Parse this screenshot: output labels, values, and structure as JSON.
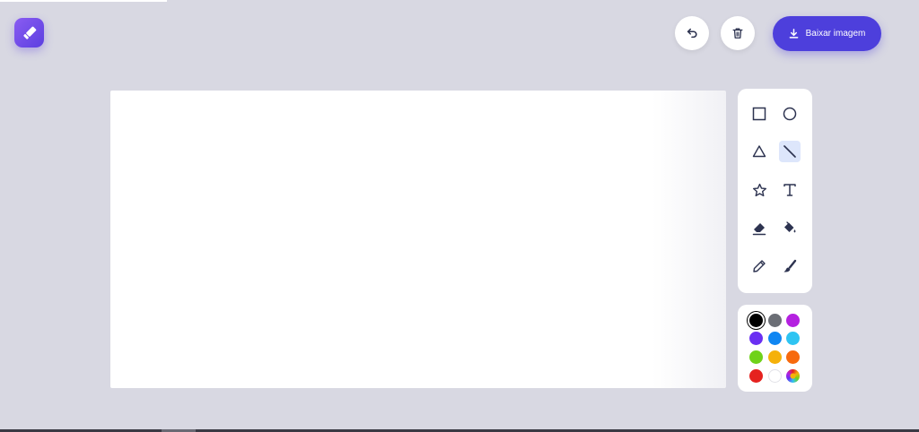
{
  "toolbar": {
    "download_label": "Baixar imagem"
  },
  "icons": {
    "logo": "pen-logo-icon",
    "undo": "undo-icon",
    "trash": "trash-icon",
    "download": "download-icon"
  },
  "tools": [
    {
      "name": "rectangle",
      "icon": "square-icon",
      "active": false
    },
    {
      "name": "circle",
      "icon": "circle-icon",
      "active": false
    },
    {
      "name": "triangle",
      "icon": "triangle-icon",
      "active": false
    },
    {
      "name": "line",
      "icon": "line-icon",
      "active": true
    },
    {
      "name": "star",
      "icon": "star-icon",
      "active": false
    },
    {
      "name": "text",
      "icon": "text-icon",
      "active": false
    },
    {
      "name": "eraser",
      "icon": "eraser-icon",
      "active": false
    },
    {
      "name": "fill",
      "icon": "paint-bucket-icon",
      "active": false
    },
    {
      "name": "pencil",
      "icon": "pencil-icon",
      "active": false
    },
    {
      "name": "brush",
      "icon": "brush-icon",
      "active": false
    }
  ],
  "colors": [
    {
      "name": "black",
      "hex": "#000000",
      "selected": true
    },
    {
      "name": "gray",
      "hex": "#6b6e75",
      "selected": false
    },
    {
      "name": "purple",
      "hex": "#b421e0",
      "selected": false
    },
    {
      "name": "violet",
      "hex": "#6a2ff2",
      "selected": false
    },
    {
      "name": "blue",
      "hex": "#0f86f2",
      "selected": false
    },
    {
      "name": "sky",
      "hex": "#2ec4f2",
      "selected": false
    },
    {
      "name": "green",
      "hex": "#6fd21a",
      "selected": false
    },
    {
      "name": "amber",
      "hex": "#f5b10a",
      "selected": false
    },
    {
      "name": "orange",
      "hex": "#f76a0e",
      "selected": false
    },
    {
      "name": "red",
      "hex": "#e5221f",
      "selected": false
    },
    {
      "name": "white",
      "hex": "#ffffff",
      "selected": false
    },
    {
      "name": "custom",
      "hex": "conic",
      "selected": false
    }
  ],
  "theme": {
    "background": "#d8d8e2",
    "accent": "#4d3fdc",
    "icon": "#2d3350",
    "active_tool": "#dde6fb"
  }
}
